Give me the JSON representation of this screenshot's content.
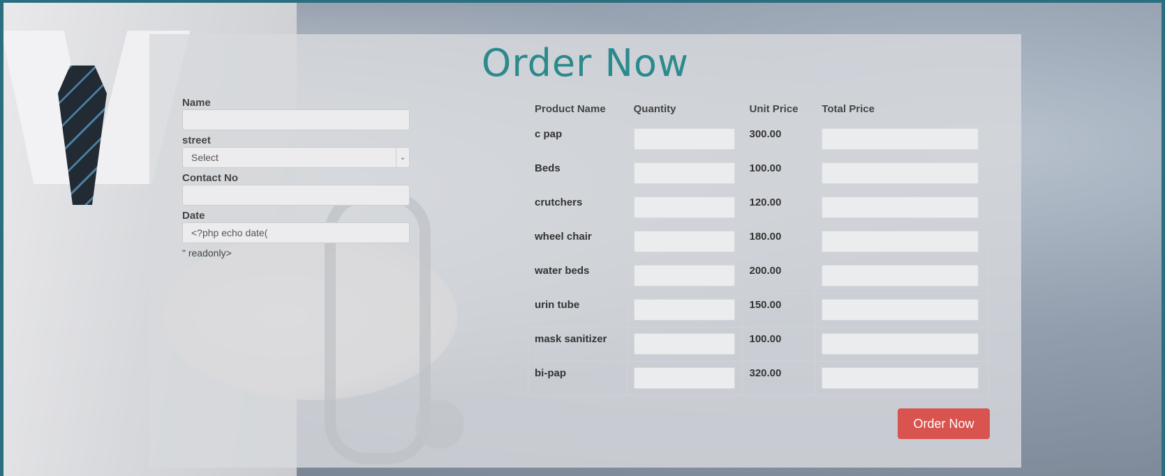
{
  "title": "Order Now",
  "form": {
    "name_label": "Name",
    "name_value": "",
    "street_label": "street",
    "street_selected": "Select",
    "contact_label": "Contact No",
    "contact_value": "",
    "date_label": "Date",
    "date_value": "<?php echo date(",
    "date_trailing_text": "\" readonly>"
  },
  "table": {
    "headers": [
      "Product Name",
      "Quantity",
      "Unit Price",
      "Total Price"
    ],
    "rows": [
      {
        "product": "c pap",
        "unit_price": "300.00"
      },
      {
        "product": "Beds",
        "unit_price": "100.00"
      },
      {
        "product": "crutchers",
        "unit_price": "120.00"
      },
      {
        "product": "wheel chair",
        "unit_price": "180.00"
      },
      {
        "product": "water beds",
        "unit_price": "200.00"
      },
      {
        "product": "urin tube",
        "unit_price": "150.00"
      },
      {
        "product": "mask sanitizer",
        "unit_price": "100.00"
      },
      {
        "product": "bi-pap",
        "unit_price": "320.00"
      }
    ]
  },
  "submit_label": "Order Now",
  "colors": {
    "title": "#2b8a8c",
    "button": "#d9534f",
    "frame": "#2a6f80"
  }
}
